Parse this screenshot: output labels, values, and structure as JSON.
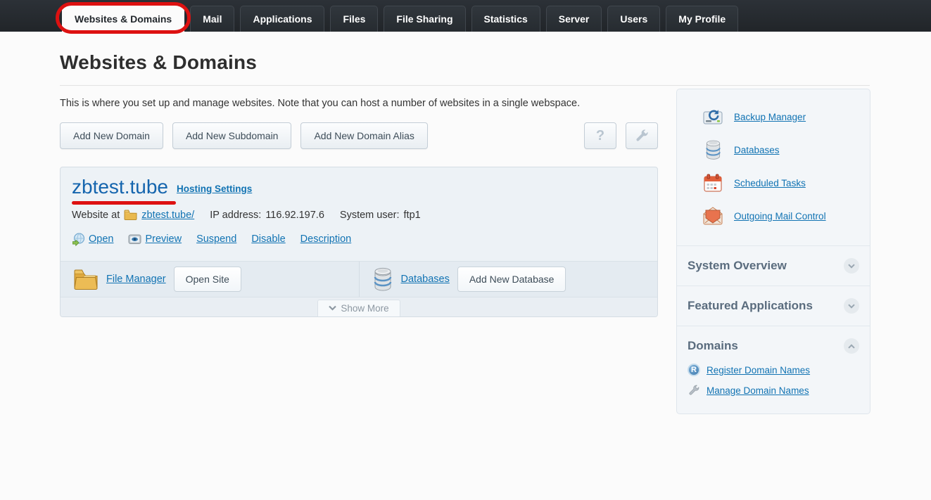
{
  "nav": {
    "tabs": [
      {
        "label": "Websites & Domains",
        "active": true
      },
      {
        "label": "Mail"
      },
      {
        "label": "Applications"
      },
      {
        "label": "Files"
      },
      {
        "label": "File Sharing"
      },
      {
        "label": "Statistics"
      },
      {
        "label": "Server"
      },
      {
        "label": "Users"
      },
      {
        "label": "My Profile"
      }
    ]
  },
  "page": {
    "title": "Websites & Domains",
    "description": "This is where you set up and manage websites. Note that you can host a number of websites in a single webspace."
  },
  "toolbar": {
    "add_domain": "Add New Domain",
    "add_subdomain": "Add New Subdomain",
    "add_alias": "Add New Domain Alias",
    "help": "?"
  },
  "domain": {
    "name": "zbtest.tube",
    "hosting_settings": "Hosting Settings",
    "website_at_label": "Website at",
    "folder_link": "zbtest.tube/",
    "ip_label": "IP address:",
    "ip_value": "116.92.197.6",
    "user_label": "System user:",
    "user_value": "ftp1",
    "links": [
      {
        "label": "Open"
      },
      {
        "label": "Preview"
      },
      {
        "label": "Suspend"
      },
      {
        "label": "Disable"
      },
      {
        "label": "Description"
      }
    ],
    "file_manager": "File Manager",
    "open_site": "Open Site",
    "databases": "Databases",
    "add_database": "Add New Database",
    "show_more": "Show More"
  },
  "sidebar": {
    "quick_links": [
      {
        "label": "Backup Manager",
        "icon": "backup-icon"
      },
      {
        "label": "Databases",
        "icon": "database-icon"
      },
      {
        "label": "Scheduled Tasks",
        "icon": "calendar-icon"
      },
      {
        "label": "Outgoing Mail Control",
        "icon": "mail-icon"
      }
    ],
    "sections": [
      {
        "title": "System Overview",
        "state": "collapsed"
      },
      {
        "title": "Featured Applications",
        "state": "collapsed"
      },
      {
        "title": "Domains",
        "state": "expanded"
      }
    ],
    "domain_links": [
      {
        "label": "Register Domain Names",
        "icon": "registrar-icon"
      },
      {
        "label": "Manage Domain Names",
        "icon": "wrench-icon"
      }
    ]
  },
  "colors": {
    "annotation_red": "#dd1111",
    "link_blue": "#1173b3",
    "domain_title_blue": "#1565ae",
    "nav_dark": "#24282c"
  }
}
